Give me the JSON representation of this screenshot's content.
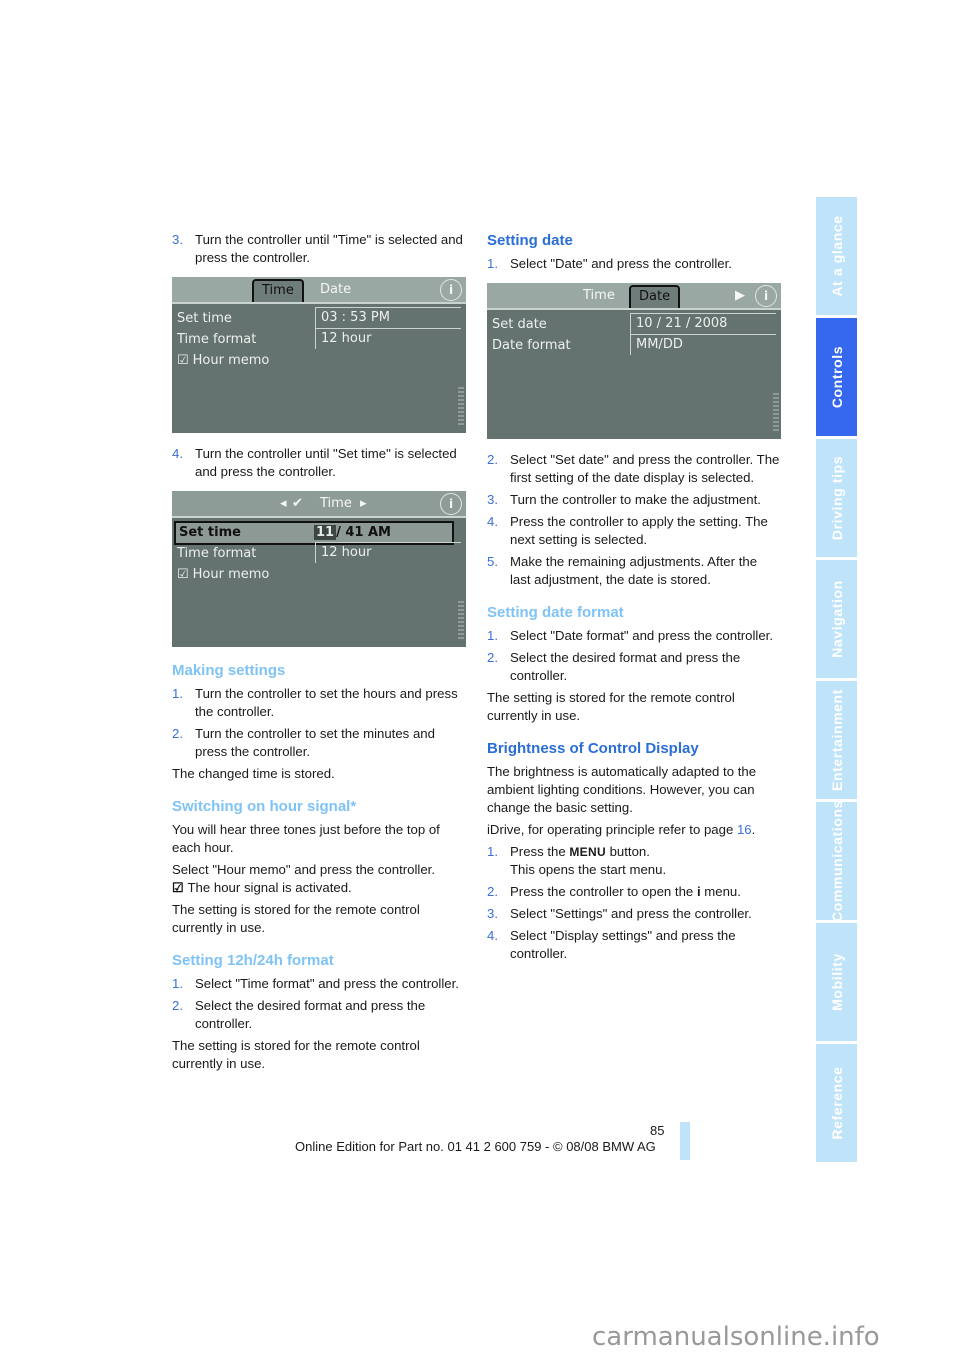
{
  "page_number": "85",
  "footer": {
    "edition": "Online Edition for Part no. 01 41 2 600 759 - © 08/08 BMW AG"
  },
  "watermark": "carmanualsonline.info",
  "sidebar": {
    "tabs": [
      {
        "label": "At a glance",
        "active": false
      },
      {
        "label": "Controls",
        "active": true
      },
      {
        "label": "Driving tips",
        "active": false
      },
      {
        "label": "Navigation",
        "active": false
      },
      {
        "label": "Entertainment",
        "active": false
      },
      {
        "label": "Communications",
        "active": false
      },
      {
        "label": "Mobility",
        "active": false
      },
      {
        "label": "Reference",
        "active": false
      }
    ],
    "colors": {
      "active": "#3568ee",
      "inactive": "#bfe3f8"
    }
  },
  "left": {
    "step3": {
      "num": "3.",
      "text": "Turn the controller until \"Time\" is selected and press the controller."
    },
    "screen1": {
      "tabs": [
        "Time",
        "Date"
      ],
      "active_tab": "Time",
      "rows": [
        {
          "label": "Set time",
          "value": "03 : 53 PM"
        },
        {
          "label": "Time format",
          "value": "12 hour"
        },
        {
          "label": "Hour memo",
          "checked": true
        }
      ]
    },
    "step4": {
      "num": "4.",
      "text": "Turn the controller until \"Set time\" is selected and press the controller."
    },
    "screen2": {
      "title": "Time",
      "nav_left": "◂",
      "nav_right": "▸",
      "rows": [
        {
          "label": "Set time",
          "value_highlight": "11",
          "value_rest": "/ 41 AM"
        },
        {
          "label": "Time format",
          "value": "12 hour"
        },
        {
          "label": "Hour memo",
          "checked": true
        }
      ]
    },
    "making_settings": {
      "heading": "Making settings",
      "steps": [
        {
          "num": "1.",
          "text": "Turn the controller to set the hours and press the controller."
        },
        {
          "num": "2.",
          "text": "Turn the controller to set the minutes and press the controller."
        }
      ],
      "note": "The changed time is stored."
    },
    "hour_signal": {
      "heading": "Switching on hour signal*",
      "p1": "You will hear three tones just before the top of each hour.",
      "p2": "Select \"Hour memo\" and press the controller.",
      "p3": "The hour signal is activated.",
      "p4": "The setting is stored for the remote control currently in use."
    },
    "format": {
      "heading": "Setting 12h/24h format",
      "steps": [
        {
          "num": "1.",
          "text": "Select \"Time format\" and press the controller."
        },
        {
          "num": "2.",
          "text": "Select the desired format and press the controller."
        }
      ],
      "note": "The setting is stored for the remote control currently in use."
    }
  },
  "right": {
    "setting_date": {
      "heading": "Setting date",
      "step1": {
        "num": "1.",
        "text": "Select \"Date\" and press the controller."
      },
      "screen": {
        "tabs": [
          "Time",
          "Date"
        ],
        "active_tab": "Date",
        "rows": [
          {
            "label": "Set date",
            "value": "10 / 21 / 2008"
          },
          {
            "label": "Date format",
            "value": "MM/DD"
          }
        ]
      },
      "steps": [
        {
          "num": "2.",
          "text": "Select \"Set date\" and press the controller. The first setting of the date display is selected."
        },
        {
          "num": "3.",
          "text": "Turn the controller to make the adjustment."
        },
        {
          "num": "4.",
          "text": "Press the controller to apply the setting. The next setting is selected."
        },
        {
          "num": "5.",
          "text": "Make the remaining adjustments. After the last adjustment, the date is stored."
        }
      ]
    },
    "date_format": {
      "heading": "Setting date format",
      "steps": [
        {
          "num": "1.",
          "text": "Select \"Date format\" and press the controller."
        },
        {
          "num": "2.",
          "text": "Select the desired format and press the controller."
        }
      ],
      "note": "The setting is stored for the remote control currently in use."
    },
    "brightness": {
      "heading": "Brightness of Control Display",
      "p1": "The brightness is automatically adapted to the ambient lighting conditions. However, you can change the basic setting.",
      "p2_prefix": "iDrive, for operating principle refer to page ",
      "p2_link": "16",
      "p2_suffix": ".",
      "step1": {
        "num": "1.",
        "pre": "Press the ",
        "key": "MENU",
        "post": " button.",
        "line2": "This opens the start menu."
      },
      "step2": {
        "num": "2.",
        "pre": "Press the controller to open the ",
        "icon": "i",
        "post": " menu."
      },
      "step3": {
        "num": "3.",
        "text": "Select \"Settings\" and press the controller."
      },
      "step4": {
        "num": "4.",
        "text": "Select \"Display settings\" and press the controller."
      }
    }
  }
}
